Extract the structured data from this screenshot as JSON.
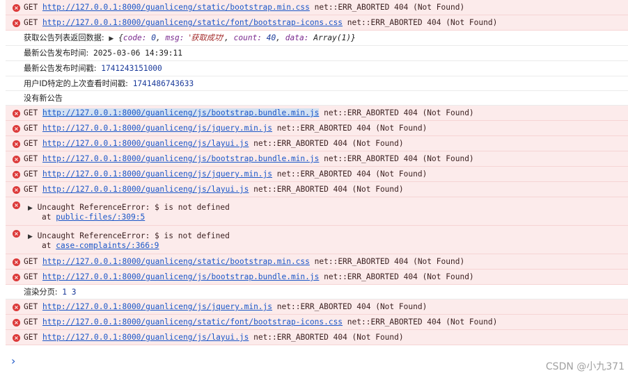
{
  "rows": [
    {
      "method": "GET",
      "url": "http://127.0.0.1:8000/guanliceng/static/bootstrap.min.css",
      "status": "net::ERR_ABORTED 404 (Not Found)"
    },
    {
      "method": "GET",
      "url": "http://127.0.0.1:8000/guanliceng/static/font/bootstrap-icons.css",
      "status": "net::ERR_ABORTED 404 (Not Found)"
    },
    {
      "log_label": "获取公告列表返回数据:",
      "obj": {
        "open": "{",
        "k_code": "code:",
        "v_code": "0",
        "k_msg": "msg:",
        "v_msg": "'获取成功'",
        "k_count": "count:",
        "v_count": "40",
        "k_data": "data:",
        "v_data": "Array(1)",
        "close": "}",
        "sep": ","
      }
    },
    {
      "log_label": "最新公告发布时间:",
      "value": "2025-03-06 14:39:11"
    },
    {
      "log_label": "最新公告发布时间戳:",
      "value": "1741243151000"
    },
    {
      "log_label": "用户ID特定的上次查看时间戳:",
      "value": "1741486743633"
    },
    {
      "log_label": "没有新公告"
    },
    {
      "method": "GET",
      "url": "http://127.0.0.1:8000/guanliceng/js/bootstrap.bundle.min.js",
      "status": "net::ERR_ABORTED 404 (Not Found)"
    },
    {
      "method": "GET",
      "url": "http://127.0.0.1:8000/guanliceng/js/jquery.min.js",
      "status": "net::ERR_ABORTED 404 (Not Found)"
    },
    {
      "method": "GET",
      "url": "http://127.0.0.1:8000/guanliceng/js/layui.js",
      "status": "net::ERR_ABORTED 404 (Not Found)"
    },
    {
      "method": "GET",
      "url": "http://127.0.0.1:8000/guanliceng/js/bootstrap.bundle.min.js",
      "status": "net::ERR_ABORTED 404 (Not Found)"
    },
    {
      "method": "GET",
      "url": "http://127.0.0.1:8000/guanliceng/js/jquery.min.js",
      "status": "net::ERR_ABORTED 404 (Not Found)"
    },
    {
      "method": "GET",
      "url": "http://127.0.0.1:8000/guanliceng/js/layui.js",
      "status": "net::ERR_ABORTED 404 (Not Found)"
    },
    {
      "error": "Uncaught ReferenceError: $ is not defined",
      "at": "at",
      "location": "public-files/:309:5"
    },
    {
      "error": "Uncaught ReferenceError: $ is not defined",
      "at": "at",
      "location": "case-complaints/:366:9"
    },
    {
      "method": "GET",
      "url": "http://127.0.0.1:8000/guanliceng/static/bootstrap.min.css",
      "status": "net::ERR_ABORTED 404 (Not Found)"
    },
    {
      "method": "GET",
      "url": "http://127.0.0.1:8000/guanliceng/js/bootstrap.bundle.min.js",
      "status": "net::ERR_ABORTED 404 (Not Found)"
    },
    {
      "log_label": "渲染分页:",
      "value": "1 3"
    },
    {
      "method": "GET",
      "url": "http://127.0.0.1:8000/guanliceng/js/jquery.min.js",
      "status": "net::ERR_ABORTED 404 (Not Found)"
    },
    {
      "method": "GET",
      "url": "http://127.0.0.1:8000/guanliceng/static/font/bootstrap-icons.css",
      "status": "net::ERR_ABORTED 404 (Not Found)"
    },
    {
      "method": "GET",
      "url": "http://127.0.0.1:8000/guanliceng/js/layui.js",
      "status": "net::ERR_ABORTED 404 (Not Found)"
    }
  ],
  "icons": {
    "error": "error-x-icon",
    "expand": "expand-triangle-icon",
    "prompt": "chevron-right-icon"
  },
  "glyphs": {
    "error": "×",
    "expand": "▶",
    "prompt": "›"
  },
  "colors": {
    "error_bg": "#fcebeb",
    "error_icon": "#dc3a3a",
    "link": "#1a56c8",
    "number": "#1a3a9a",
    "watermark": "#a0a0a0"
  },
  "watermark": "CSDN @小九371"
}
